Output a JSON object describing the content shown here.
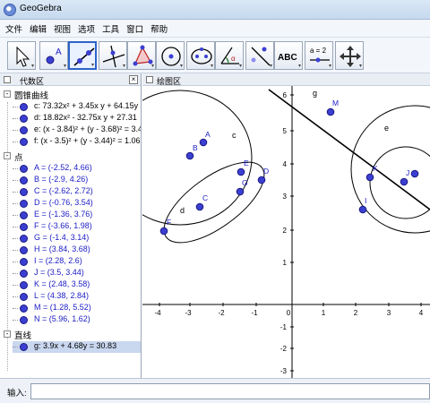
{
  "window": {
    "title": "GeoGebra"
  },
  "menu": [
    "文件",
    "编辑",
    "视图",
    "选项",
    "工具",
    "窗口",
    "帮助"
  ],
  "toolbar": {
    "tools": [
      {
        "name": "move"
      },
      {
        "name": "point",
        "label": "A"
      },
      {
        "name": "line-through-two-points"
      },
      {
        "name": "perpendicular-line"
      },
      {
        "name": "polygon"
      },
      {
        "name": "circle-center-point"
      },
      {
        "name": "ellipse"
      },
      {
        "name": "angle",
        "label": "α"
      },
      {
        "name": "reflect-about-line"
      },
      {
        "name": "text",
        "label": "ABC"
      },
      {
        "name": "slider",
        "label": "a = 2"
      },
      {
        "name": "move-graphics-view"
      }
    ],
    "selected": "line-through-two-points"
  },
  "algebra": {
    "title": "代数区",
    "groups": [
      {
        "name": "圆锥曲线",
        "items": [
          "c: 73.32x² + 3.45x y + 64.15y",
          "d: 18.82x² - 32.75x y + 27.31",
          "e: (x - 3.84)² + (y - 3.68)² = 3.4",
          "f: (x - 3.5)² + (y - 3.44)² = 1.06"
        ]
      },
      {
        "name": "点",
        "items": [
          "A = (-2.52, 4.66)",
          "B = (-2.9, 4.26)",
          "C = (-2.62, 2.72)",
          "D = (-0.76, 3.54)",
          "E = (-1.36, 3.76)",
          "F = (-3.66, 1.98)",
          "G = (-1.4, 3.14)",
          "H = (3.84, 3.68)",
          "I = (2.28, 2.6)",
          "J = (3.5, 3.44)",
          "K = (2.48, 3.58)",
          "L = (4.38, 2.84)",
          "M = (1.28, 5.52)",
          "N = (5.96, 1.62)"
        ]
      },
      {
        "name": "直线",
        "items": [
          "g: 3.9x + 4.68y = 30.83"
        ]
      }
    ]
  },
  "graphics": {
    "title": "绘图区",
    "x_ticks": [
      "-4",
      "-3",
      "-2",
      "-1",
      "0",
      "1",
      "2",
      "3",
      "4"
    ],
    "y_ticks": [
      "6",
      "5",
      "4",
      "3",
      "2",
      "1",
      "-1",
      "-2",
      "-3"
    ],
    "point_labels": [
      "A",
      "B",
      "C",
      "D",
      "E",
      "F",
      "G",
      "I",
      "J",
      "K",
      "M"
    ],
    "object_labels": [
      "c",
      "d",
      "e",
      "g"
    ]
  },
  "input": {
    "label": "输入:",
    "value": ""
  },
  "colors": {
    "point": "#3b3fd1",
    "accent": "#2c63c9",
    "conic": "#000000"
  }
}
